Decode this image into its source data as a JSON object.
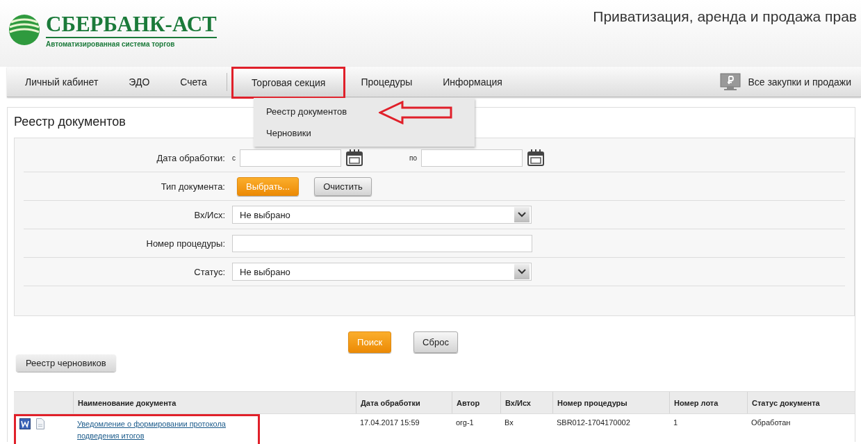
{
  "header": {
    "logo_name": "СБЕРБАНК-АСТ",
    "logo_subtitle": "Автоматизированная система торгов",
    "title": "Приватизация, аренда и продажа прав"
  },
  "nav": {
    "groups": [
      [
        {
          "label": "Личный кабинет",
          "highlighted": false
        },
        {
          "label": "ЭДО",
          "highlighted": false
        },
        {
          "label": "Счета",
          "highlighted": false
        }
      ],
      [
        {
          "label": "Торговая секция",
          "highlighted": true
        },
        {
          "label": "Процедуры",
          "highlighted": false
        },
        {
          "label": "Информация",
          "highlighted": false
        }
      ]
    ],
    "right_link": "Все закупки и продажи",
    "dropdown": [
      {
        "label": "Реестр документов",
        "pointed": true
      },
      {
        "label": "Черновики",
        "pointed": false
      }
    ]
  },
  "page_title": "Реестр документов",
  "filters": [
    {
      "kind": "daterange",
      "label": "Дата обработки:",
      "from_label": "с",
      "to_label": "по"
    },
    {
      "kind": "buttons",
      "label": "Тип документа:",
      "buttons": [
        {
          "label": "Выбрать...",
          "primary": true
        },
        {
          "label": "Очистить",
          "primary": false
        }
      ]
    },
    {
      "kind": "select",
      "label": "Вх/Исх:",
      "value": "Не выбрано"
    },
    {
      "kind": "text",
      "label": "Номер процедуры:"
    },
    {
      "kind": "select",
      "label": "Статус:",
      "value": "Не выбрано"
    }
  ],
  "actions": [
    {
      "label": "Поиск",
      "primary": true
    },
    {
      "label": "Сброс",
      "primary": false
    }
  ],
  "drafts_button": "Реестр черновиков",
  "table": {
    "columns": [
      "Наименование документа",
      "Дата обработки",
      "Автор",
      "Вх/Исх",
      "Номер процедуры",
      "Номер лота",
      "Статус документа"
    ],
    "rows": [
      {
        "highlighted": true,
        "files": [
          {
            "kind": "word"
          },
          {
            "kind": "plain"
          }
        ],
        "cells": [
          "Уведомление о формировании протокола подведения итогов",
          "17.04.2017 15:59",
          "org-1",
          "Вх",
          "SBR012-1704170002",
          "1",
          "Обработан"
        ]
      }
    ]
  }
}
